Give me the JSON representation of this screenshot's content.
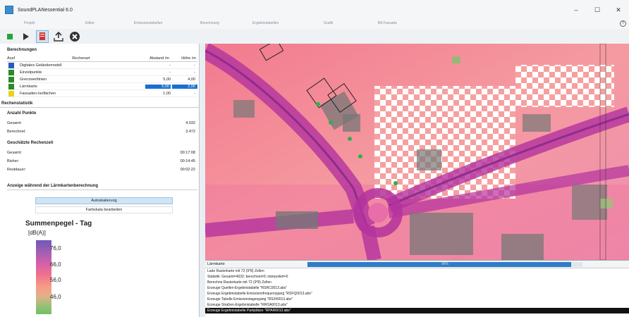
{
  "window": {
    "title": "SoundPLANessential 6.0",
    "controls": [
      "–",
      "☐",
      "✕"
    ]
  },
  "menu": {
    "items": [
      "Projekt",
      "Editor",
      "Emissionstabellen",
      "Berechnung",
      "Ergebnistabellen",
      "Grafik",
      "BA Fassade"
    ],
    "help": "?"
  },
  "toolbar": {
    "icons": [
      "start-green-icon",
      "play-icon",
      "document-red-icon",
      "export-icon",
      "cancel-icon"
    ]
  },
  "berechnungen": {
    "title": "Berechnungen",
    "cols": [
      "Ausf",
      "Rechenart",
      "Abstand /m",
      "Höhe /m"
    ],
    "rows": [
      {
        "name": "Digitales Geländemodell",
        "abstand": "-",
        "hoehe": "-",
        "color": "#1f5fbf"
      },
      {
        "name": "Einzelpunkte",
        "abstand": "-",
        "hoehe": "-",
        "color": "#2a8a2a"
      },
      {
        "name": "Grenzwertlinien",
        "abstand": "5,00",
        "hoehe": "4,00",
        "color": "#2a8a2a"
      },
      {
        "name": "Lärmkarte",
        "abstand": "5,00",
        "hoehe": "2,00",
        "color": "#2a8a2a"
      },
      {
        "name": "Fassaden-Isoflächen",
        "abstand": "1,00",
        "hoehe": "-",
        "color": "#e8d21a"
      }
    ]
  },
  "rechenstatistik": {
    "title": "Rechenstatistik",
    "anzahl_title": "Anzahl Punkte",
    "gesamt_label": "Gesamt:",
    "gesamt": "4.032",
    "berechnet_label": "Berechnet:",
    "berechnet": "3.472",
    "zeit_title": "Geschätzte Rechenzeit",
    "zeit_gesamt_label": "Gesamt:",
    "zeit_gesamt": "00:17:08",
    "bisher_label": "Bisher:",
    "bisher": "00:14:45",
    "rest_label": "Restdauer:",
    "rest": "00:02:22"
  },
  "anzeige": {
    "title": "Anzeige während der Lärmkartenberechnung",
    "autoskalierung": "Autoskalierung",
    "farbskala": "Farbskala bearbeiten"
  },
  "legend": {
    "title": "Summenpegel - Tag",
    "unit": "[dB(A)]",
    "ticks": [
      "76,0",
      "66,0",
      "56,0",
      "46,0"
    ]
  },
  "log": {
    "title": "Lärmkarte",
    "progress": 0.96,
    "progress_label": "96%",
    "lines": [
      "Lade Rasterkarte mit 72 (9*8) Zellen",
      "Statistik: Gesamt=4032; berechnet=0; interpoliert=0",
      "Berechne Rasterkarte mit 72 (9*8) Zellen",
      "Erzeuge Quellen-Ergebnistabelle \"RSRC0013.abs\"",
      "Erzeuge Ergebnistabelle Emissionsfrequenzgang \"RSFQ0013.abs\"",
      "Erzeuge Tabelle Emissionstagesgang \"RS240013.abs\"",
      "Erzeuge Straßen-Ergebnistabelle \"RROA0013.abs\"",
      "Erzeuge Ergebnistabelle Parkplätze \"RPAR0013.abs\""
    ]
  }
}
